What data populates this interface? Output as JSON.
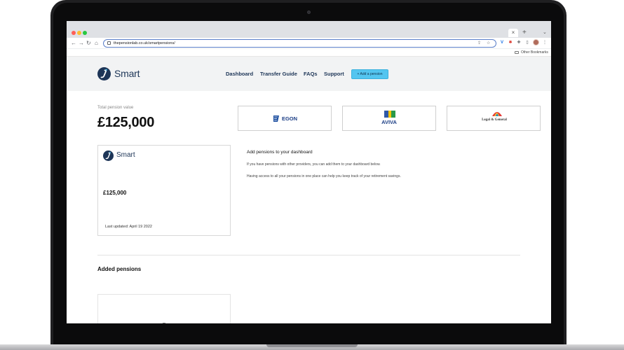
{
  "browser": {
    "url": "thepensionlab.co.uk/smartpensions/",
    "new_tab_glyph": "+",
    "close_tab_glyph": "×",
    "tab_menu_glyph": "⌄",
    "bookmarks_label": "Other Bookmarks"
  },
  "site": {
    "brand": "Smart",
    "nav": [
      {
        "label": "Dashboard"
      },
      {
        "label": "Transfer Guide"
      },
      {
        "label": "FAQs"
      },
      {
        "label": "Support"
      }
    ],
    "add_pension_label": "+ Add a pension",
    "accent_color": "#53c5f0",
    "brand_color": "#1d3557"
  },
  "summary": {
    "total_label": "Total pension value",
    "total_value": "£125,000"
  },
  "providers": [
    {
      "name": "EGON",
      "icon": "aegon-logo"
    },
    {
      "name": "AVIVA",
      "icon": "aviva-logo"
    },
    {
      "name": "Legal & General",
      "icon": "legal-general-umbrella-logo"
    }
  ],
  "smart_card": {
    "brand": "Smart",
    "value": "£125,000",
    "updated": "Last updated: April 19 2022"
  },
  "add_section": {
    "title": "Add pensions to your dashboard",
    "line1": "If you have pensions with other providers, you can add them to your dashboard below.",
    "line2": "Having access to all your pensions in one place can help you keep track of your retirement savings."
  },
  "added_section": {
    "title": "Added pensions"
  }
}
